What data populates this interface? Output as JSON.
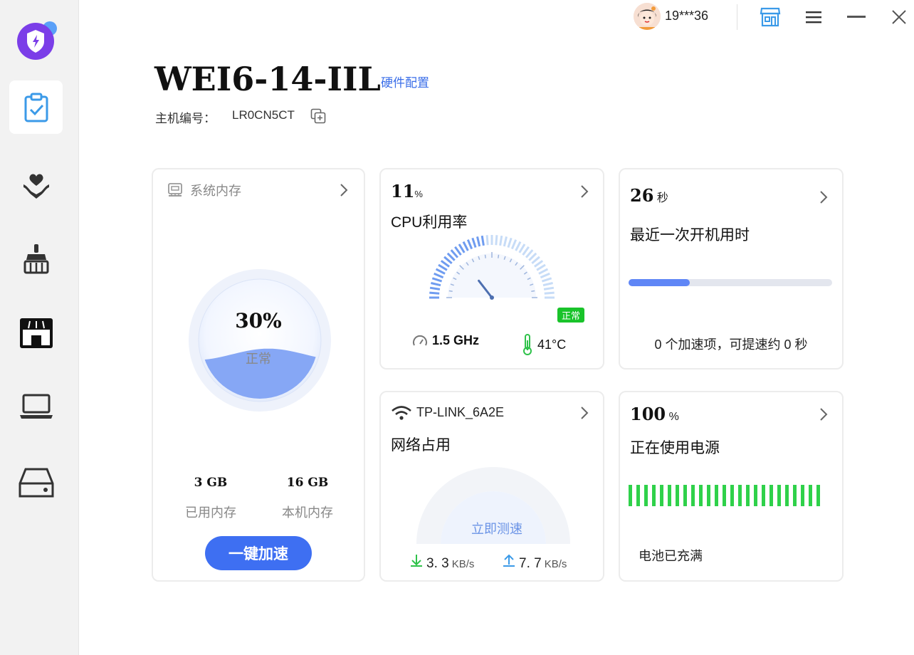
{
  "user": {
    "name": "19***36"
  },
  "header": {
    "device_name": "WEI6-14-IIL",
    "hardware_link": "硬件配置",
    "host_label": "主机编号：",
    "host_id": "LR0CN5CT"
  },
  "memory_card": {
    "title": "系统内存",
    "percent": "30%",
    "percent_value": 30,
    "status": "正常",
    "used_value": "3 GB",
    "used_label": "已用内存",
    "total_value": "16 GB",
    "total_label": "本机内存",
    "boost_button": "一键加速"
  },
  "cpu_card": {
    "value": "11",
    "unit": "%",
    "title": "CPU利用率",
    "badge": "正常",
    "frequency": "1.5 GHz",
    "temperature": "41°C",
    "gauge_fraction": 0.11
  },
  "boot_card": {
    "value": "26",
    "unit": "秒",
    "title": "最近一次开机用时",
    "progress_fraction": 0.3,
    "note": "0 个加速项，可提速约 0 秒"
  },
  "network_card": {
    "ssid": "TP-LINK_6A2E",
    "title": "网络占用",
    "speedtest_button": "立即测速",
    "download_value": "3. 3",
    "download_unit": "KB/s",
    "upload_value": "7. 7",
    "upload_unit": "KB/s"
  },
  "power_card": {
    "value": "100",
    "unit": "%",
    "title": "正在使用电源",
    "battery_fraction": 1.0,
    "note": "电池已充满"
  },
  "colors": {
    "accent": "#3e6ff2",
    "link": "#3a6ee8",
    "battery_green": "#2fd14a",
    "badge_green": "#19c32a",
    "progress_blue": "#5f86f6",
    "logo_purple": "#7b3ee8"
  },
  "icons": {
    "sidebar": [
      "checklist-icon",
      "heart-hand-icon",
      "broom-icon",
      "store-icon",
      "laptop-icon",
      "disk-drive-icon"
    ],
    "topbar": [
      "store-icon",
      "menu-icon",
      "minimize-icon",
      "close-icon"
    ]
  }
}
